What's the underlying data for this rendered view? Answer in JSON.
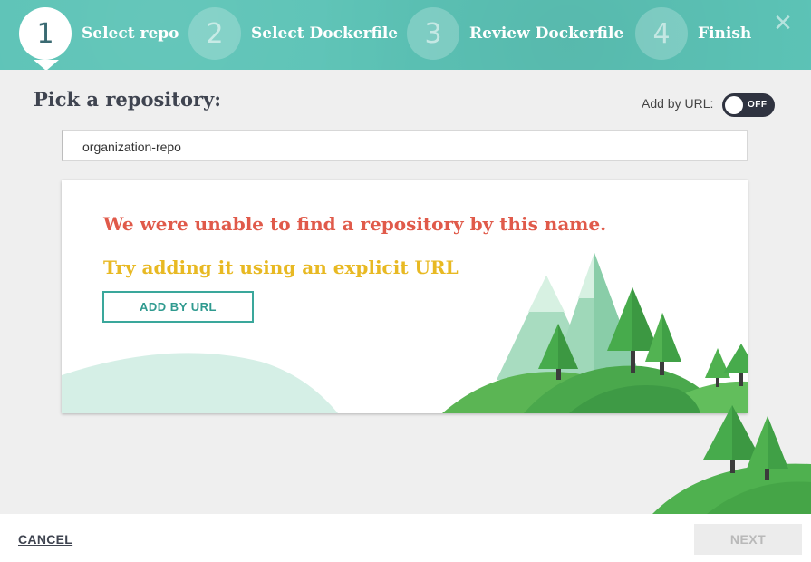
{
  "stepper": {
    "steps": [
      {
        "number": "1",
        "label": "Select repo",
        "active": true
      },
      {
        "number": "2",
        "label": "Select Dockerfile",
        "active": false
      },
      {
        "number": "3",
        "label": "Review Dockerfile",
        "active": false
      },
      {
        "number": "4",
        "label": "Finish",
        "active": false
      }
    ],
    "close_icon": "close-icon",
    "close_glyph": "✕"
  },
  "main": {
    "title": "Pick a repository:",
    "toggle": {
      "label": "Add by URL:",
      "state": "OFF"
    },
    "repo_input": {
      "value": "organization-repo",
      "placeholder": ""
    }
  },
  "empty_state": {
    "error_message": "We were unable to find a repository by this name.",
    "hint": "Try adding it using an explicit URL",
    "add_by_url_button": "ADD BY URL",
    "illustration": "forest-hills-illustration"
  },
  "footer": {
    "cancel_label": "CANCEL",
    "next_label": "NEXT"
  },
  "colors": {
    "header": "#5cc3b6",
    "error": "#e05a4a",
    "hint": "#e8b923",
    "accent": "#3aa79b"
  }
}
